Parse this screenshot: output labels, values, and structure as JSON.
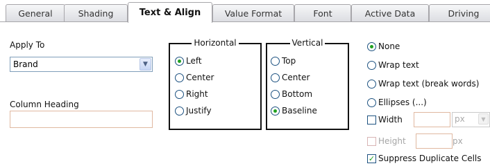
{
  "tabs": [
    {
      "label": "General",
      "active": false
    },
    {
      "label": "Shading",
      "active": false
    },
    {
      "label": "Text & Align",
      "active": true
    },
    {
      "label": "Value Format",
      "active": false
    },
    {
      "label": "Font",
      "active": false
    },
    {
      "label": "Active Data",
      "active": false
    },
    {
      "label": "Driving",
      "active": false
    }
  ],
  "apply_to": {
    "label": "Apply To",
    "value": "Brand"
  },
  "column_heading": {
    "label": "Column Heading",
    "value": ""
  },
  "horizontal": {
    "title": "Horizontal",
    "options": [
      {
        "label": "Left",
        "checked": true
      },
      {
        "label": "Center",
        "checked": false
      },
      {
        "label": "Right",
        "checked": false
      },
      {
        "label": "Justify",
        "checked": false
      }
    ]
  },
  "vertical": {
    "title": "Vertical",
    "options": [
      {
        "label": "Top",
        "checked": false
      },
      {
        "label": "Center",
        "checked": false
      },
      {
        "label": "Bottom",
        "checked": false
      },
      {
        "label": "Baseline",
        "checked": true
      }
    ]
  },
  "wrap": {
    "options": [
      {
        "label": "None",
        "checked": true
      },
      {
        "label": "Wrap text",
        "checked": false
      },
      {
        "label": "Wrap text (break words)",
        "checked": false
      },
      {
        "label": "Ellipses (...)",
        "checked": false
      }
    ]
  },
  "width": {
    "label": "Width",
    "checked": false,
    "value": "",
    "unit": "px"
  },
  "height": {
    "label": "Height",
    "checked": false,
    "value": "",
    "unit": "px"
  },
  "suppress": {
    "label": "Suppress Duplicate Cells",
    "checked": true
  },
  "colors": {
    "radio_dot": "#21a121",
    "group_border": "#111111",
    "input_border": "#e0b8a0"
  }
}
